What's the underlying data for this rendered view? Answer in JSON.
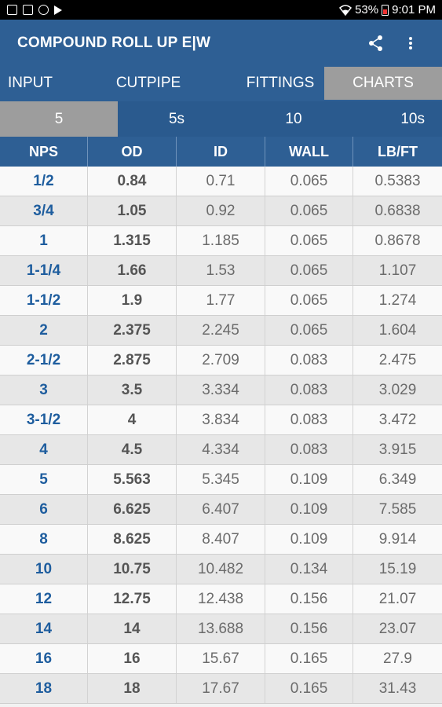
{
  "status_bar": {
    "icons": [
      "image-icon",
      "gallery-icon",
      "at-sign-icon",
      "play-store-icon"
    ],
    "wifi_icon": "wifi-icon",
    "battery_percent": "53%",
    "battery_icon": "battery-low-icon",
    "time": "9:01 PM"
  },
  "app_bar": {
    "title": "COMPOUND ROLL UP E|W",
    "share_icon": "share-icon",
    "menu_icon": "more-vert-icon"
  },
  "tabs": [
    {
      "label": "INPUT",
      "active": false
    },
    {
      "label": "CUTPIPE",
      "active": false
    },
    {
      "label": "FITTINGS",
      "active": false
    },
    {
      "label": "CHARTS",
      "active": true
    }
  ],
  "schedule_tabs": [
    {
      "label": "5",
      "active": true
    },
    {
      "label": "5s",
      "active": false
    },
    {
      "label": "10",
      "active": false
    },
    {
      "label": "10s",
      "active": false
    }
  ],
  "table": {
    "headers": [
      "NPS",
      "OD",
      "ID",
      "WALL",
      "LB/FT"
    ],
    "rows": [
      [
        "1/2",
        "0.84",
        "0.71",
        "0.065",
        "0.5383"
      ],
      [
        "3/4",
        "1.05",
        "0.92",
        "0.065",
        "0.6838"
      ],
      [
        "1",
        "1.315",
        "1.185",
        "0.065",
        "0.8678"
      ],
      [
        "1-1/4",
        "1.66",
        "1.53",
        "0.065",
        "1.107"
      ],
      [
        "1-1/2",
        "1.9",
        "1.77",
        "0.065",
        "1.274"
      ],
      [
        "2",
        "2.375",
        "2.245",
        "0.065",
        "1.604"
      ],
      [
        "2-1/2",
        "2.875",
        "2.709",
        "0.083",
        "2.475"
      ],
      [
        "3",
        "3.5",
        "3.334",
        "0.083",
        "3.029"
      ],
      [
        "3-1/2",
        "4",
        "3.834",
        "0.083",
        "3.472"
      ],
      [
        "4",
        "4.5",
        "4.334",
        "0.083",
        "3.915"
      ],
      [
        "5",
        "5.563",
        "5.345",
        "0.109",
        "6.349"
      ],
      [
        "6",
        "6.625",
        "6.407",
        "0.109",
        "7.585"
      ],
      [
        "8",
        "8.625",
        "8.407",
        "0.109",
        "9.914"
      ],
      [
        "10",
        "10.75",
        "10.482",
        "0.134",
        "15.19"
      ],
      [
        "12",
        "12.75",
        "12.438",
        "0.156",
        "21.07"
      ],
      [
        "14",
        "14",
        "13.688",
        "0.156",
        "23.07"
      ],
      [
        "16",
        "16",
        "15.67",
        "0.165",
        "27.9"
      ],
      [
        "18",
        "18",
        "17.67",
        "0.165",
        "31.43"
      ]
    ]
  },
  "colors": {
    "primary": "#2e5f94",
    "active_tab": "#9d9d9d",
    "nps_text": "#1e5d9e"
  }
}
